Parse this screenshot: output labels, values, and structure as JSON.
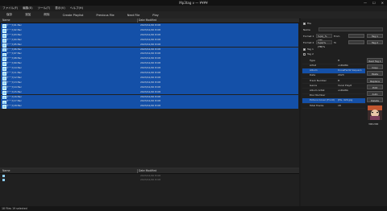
{
  "window": {
    "title": "Mp3tag v — ¥¥¥¥",
    "controls": [
      "—",
      "☐",
      "✕"
    ]
  },
  "menu": [
    "ファイル(F)",
    "編集(E)",
    "ツール(T)",
    "表示(V)",
    "ヘルプ(H)"
  ],
  "toolbar": [
    "保存",
    "追加",
    "削除",
    "Create Playlist",
    "Previous File",
    "Next File",
    "Play"
  ],
  "filelist": {
    "columns": {
      "name": "Name",
      "date": "Date Modified"
    },
    "rows": [
      {
        "name": "ケース01.flac",
        "date": "2023/12/20 8:08"
      },
      {
        "name": "ケース02.flac",
        "date": "2023/12/20 8:08"
      },
      {
        "name": "ケース03.flac",
        "date": "2023/12/20 8:08"
      },
      {
        "name": "ケース04.flac",
        "date": "2023/12/20 8:08"
      },
      {
        "name": "ケース05.flac",
        "date": "2023/12/20 8:08"
      },
      {
        "name": "ケース06.flac",
        "date": "2023/12/20 8:08"
      },
      {
        "name": "ケース07.flac",
        "date": "2023/12/20 8:08"
      },
      {
        "name": "ケース08.flac",
        "date": "2023/12/20 8:08"
      },
      {
        "name": "ケース09.flac",
        "date": "2023/12/20 8:08"
      },
      {
        "name": "ケース10.flac",
        "date": "2023/12/20 8:08"
      },
      {
        "name": "ケース11.flac",
        "date": "2023/12/20 8:08"
      },
      {
        "name": "ケース12.flac",
        "date": "2023/12/20 8:08"
      },
      {
        "name": "ケース13.flac",
        "date": "2023/12/20 8:08"
      },
      {
        "name": "ケース14.flac",
        "date": "2023/12/20 8:08"
      },
      {
        "name": "ケース15.flac",
        "date": "2023/12/20 8:08"
      },
      {
        "name": "ケース16.flac",
        "date": "2023/12/20 8:08"
      },
      {
        "name": "ケース17.flac",
        "date": "2023/12/20 8:08"
      },
      {
        "name": "ケース18.flac",
        "date": "2023/12/20 8:08"
      }
    ]
  },
  "lowerlist": {
    "columns": {
      "name": "Name",
      "date": "Date Modified"
    },
    "rows": [
      {
        "name": "",
        "date": "2023/12/20 8:08"
      },
      {
        "name": "",
        "date": "2023/12/20 8:08"
      }
    ]
  },
  "tagpanel": {
    "section_file": "File",
    "name_label": "Name",
    "format1_label": "Format 1",
    "format1_value": "%(A)_%(TB)",
    "format2_label": "Format 2",
    "format2_value": "%(A)%(TB)%",
    "from_label": "From",
    "to_label": "To",
    "tag1_button": "Tag 1",
    "tag2_button": "Tag 2",
    "section_tag1": "Tag 1",
    "section_tag2": "Tag 2",
    "type_label": "Type",
    "type_value": "tt",
    "fields": [
      {
        "key": "Artist",
        "value": "unDAWA"
      },
      {
        "key": "Album",
        "value": "KnowFel-W Vaquero"
      },
      {
        "key": "Date",
        "value": "2023"
      },
      {
        "key": "Track Number",
        "value": "tt"
      },
      {
        "key": "Genre",
        "value": "Vocal Playlt"
      },
      {
        "key": "Album Artist",
        "value": "unDAWA"
      },
      {
        "key": "Disc Number",
        "value": ""
      },
      {
        "key": "Picture Cover (Front)",
        "value": "JPG, 420.jpg"
      },
      {
        "key": "Total Tracks",
        "value": "18"
      }
    ],
    "right_buttons": [
      "Rest Tag 1",
      "Copy",
      "Paste",
      "Replace",
      "Edit",
      "Auto",
      "Delete"
    ],
    "cover_size": "300x300"
  },
  "status": "18 Files  19 selected"
}
